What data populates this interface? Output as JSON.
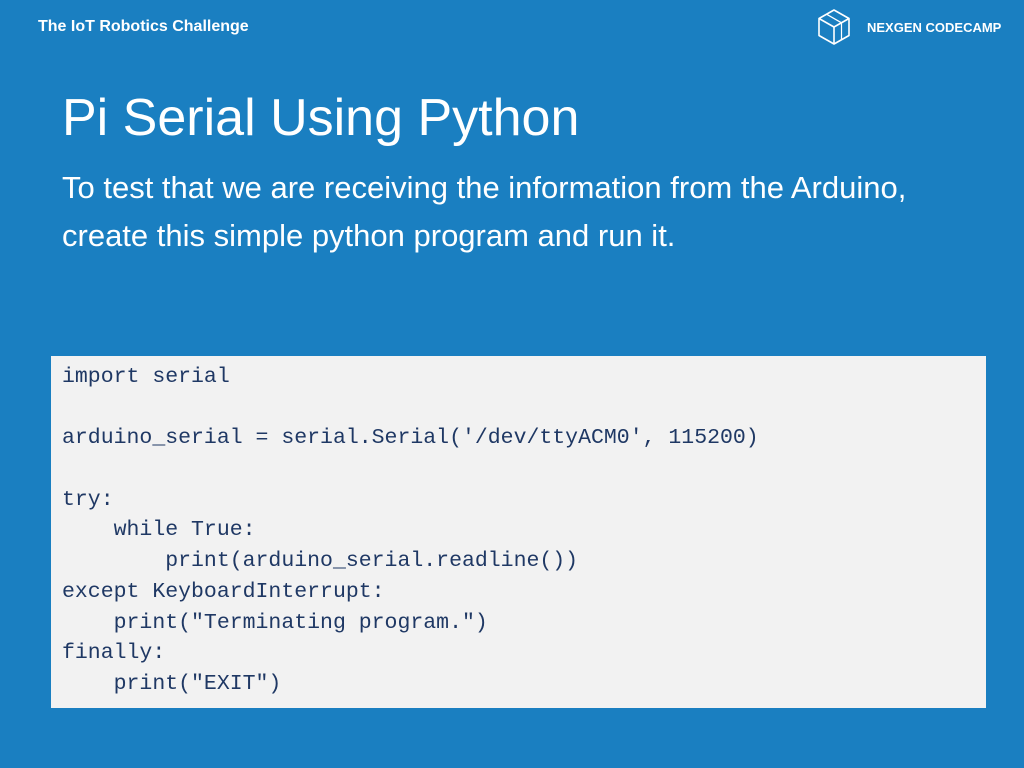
{
  "header": {
    "course_title": "The IoT Robotics Challenge",
    "brand_name": "NEXGEN CODECAMP",
    "brand_icon": "hexagon-cube-logo-icon"
  },
  "slide": {
    "title": "Pi Serial Using Python",
    "subtitle": "To test that we are receiving the information from the Arduino, create this simple python program and run it."
  },
  "code": {
    "lines": [
      "import serial",
      "",
      "arduino_serial = serial.Serial('/dev/ttyACM0', 115200)",
      "",
      "try:",
      "    while True:",
      "        print(arduino_serial.readline())",
      "except KeyboardInterrupt:",
      "    print(\"Terminating program.\")",
      "finally:",
      "    print(\"EXIT\")"
    ]
  },
  "colors": {
    "background": "#1a7fc1",
    "code_background": "#f2f2f2",
    "code_text": "#1f3864",
    "text": "#ffffff"
  }
}
